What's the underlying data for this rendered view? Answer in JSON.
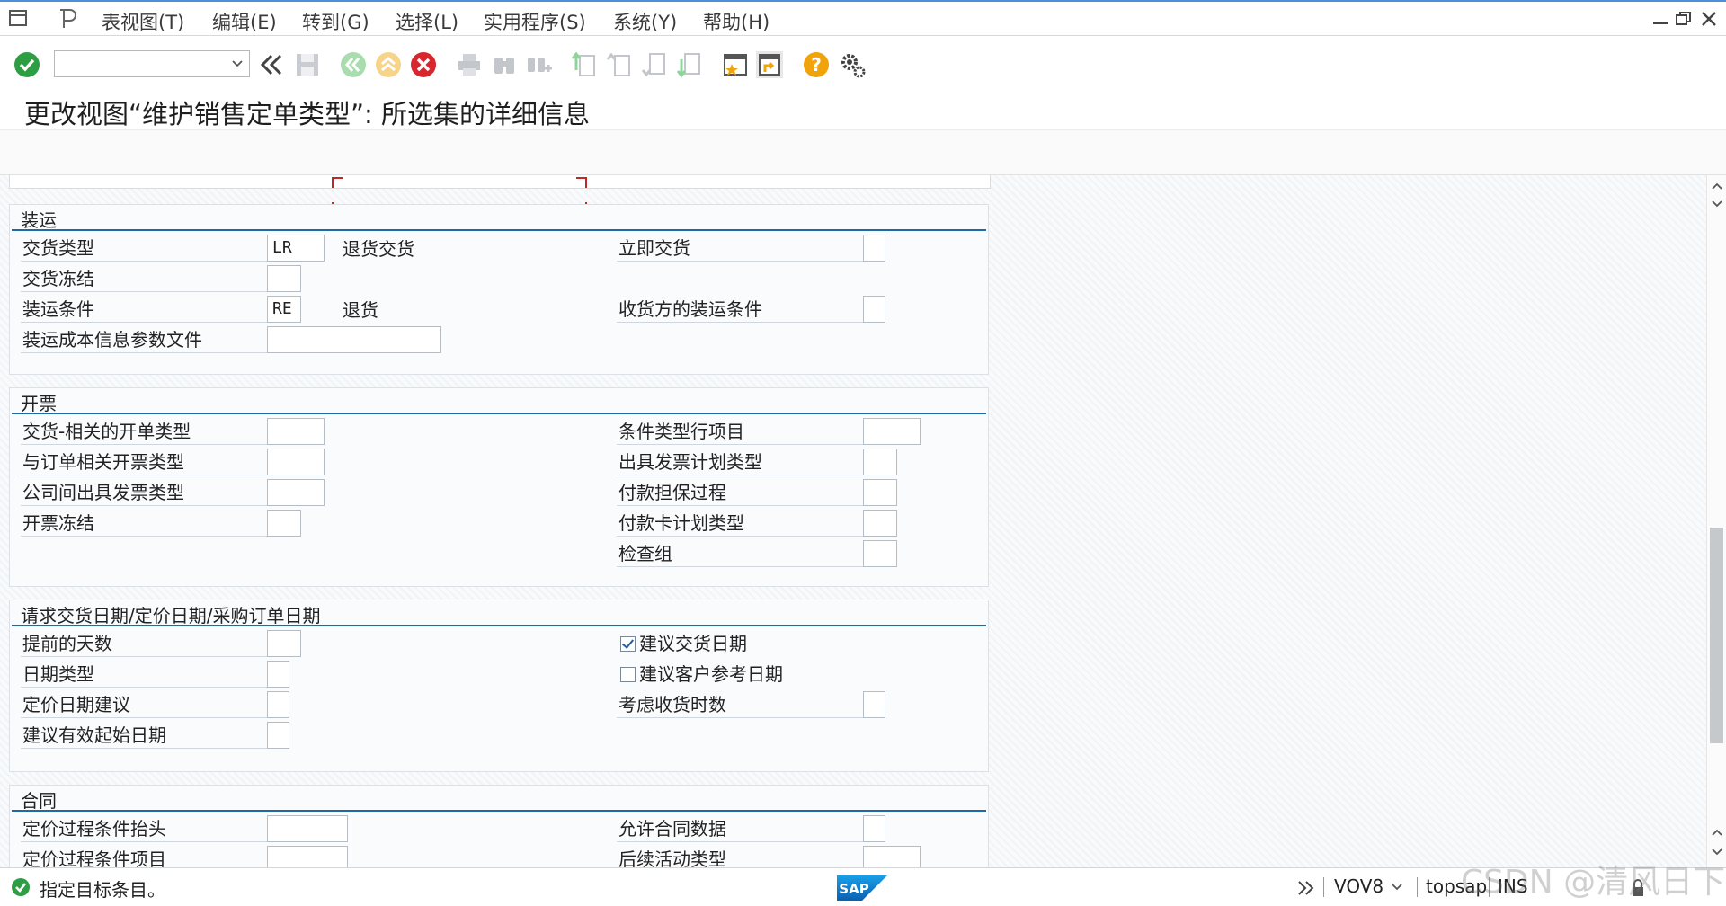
{
  "menu": {
    "items": [
      "表视图(T)",
      "编辑(E)",
      "转到(G)",
      "选择(L)",
      "实用程序(S)",
      "系统(Y)",
      "帮助(H)"
    ]
  },
  "toolbar": {
    "command_field_value": "",
    "icons": [
      "enter-check-icon",
      "back-double-arrow-icon",
      "save-icon",
      "back-icon",
      "exit-icon",
      "cancel-icon",
      "print-icon",
      "find-icon",
      "find-next-icon",
      "first-page-icon",
      "previous-page-icon",
      "next-page-icon",
      "last-page-icon",
      "create-session-icon",
      "shortcut-icon",
      "help-icon",
      "customize-layout-icon"
    ]
  },
  "title": "更改视图“维护销售定单类型”: 所选集的详细信息",
  "groups": {
    "shipping": {
      "title": "装运",
      "delivery_type_label": "交货类型",
      "delivery_type_value": "LR",
      "delivery_type_desc": "退货交货",
      "immediate_delivery_label": "立即交货",
      "delivery_block_label": "交货冻结",
      "shipping_cond_label": "装运条件",
      "shipping_cond_value": "RE",
      "shipping_cond_desc": "退货",
      "ship_to_cond_label": "收货方的装运条件",
      "ship_cost_profile_label": "装运成本信息参数文件"
    },
    "billing": {
      "title": "开票",
      "delivery_billing_label": "交货-相关的开单类型",
      "order_billing_label": "与订单相关开票类型",
      "intercompany_label": "公司间出具发票类型",
      "billing_block_label": "开票冻结",
      "cond_type_item_label": "条件类型行项目",
      "billing_plan_label": "出具发票计划类型",
      "payment_guarantee_label": "付款担保过程",
      "payment_card_label": "付款卡计划类型",
      "check_group_label": "检查组"
    },
    "dates": {
      "title": "请求交货日期/定价日期/采购订单日期",
      "lead_days_label": "提前的天数",
      "date_type_label": "日期类型",
      "pricing_date_label": "定价日期建议",
      "valid_from_label": "建议有效起始日期",
      "propose_delivery_label": "建议交货日期",
      "propose_delivery_checked": true,
      "propose_customer_label": "建议客户参考日期",
      "propose_customer_checked": false,
      "receiving_times_label": "考虑收货时数"
    },
    "contract": {
      "title": "合同",
      "pricing_header_label": "定价过程条件抬头",
      "pricing_item_label": "定价过程条件项目",
      "allow_contract_label": "允许合同数据",
      "follow_up_label": "后续活动类型"
    }
  },
  "status": {
    "message": "指定目标条目。",
    "transaction": "VOV8",
    "server": "topsap",
    "mode": "INS",
    "logo": "SAP"
  },
  "watermark": "CSDN @清风日下",
  "colors": {
    "accent": "#1f6aa5",
    "menu_top_border": "#4a8fd8",
    "success": "#2e9e44",
    "focus": "#c0272d"
  }
}
